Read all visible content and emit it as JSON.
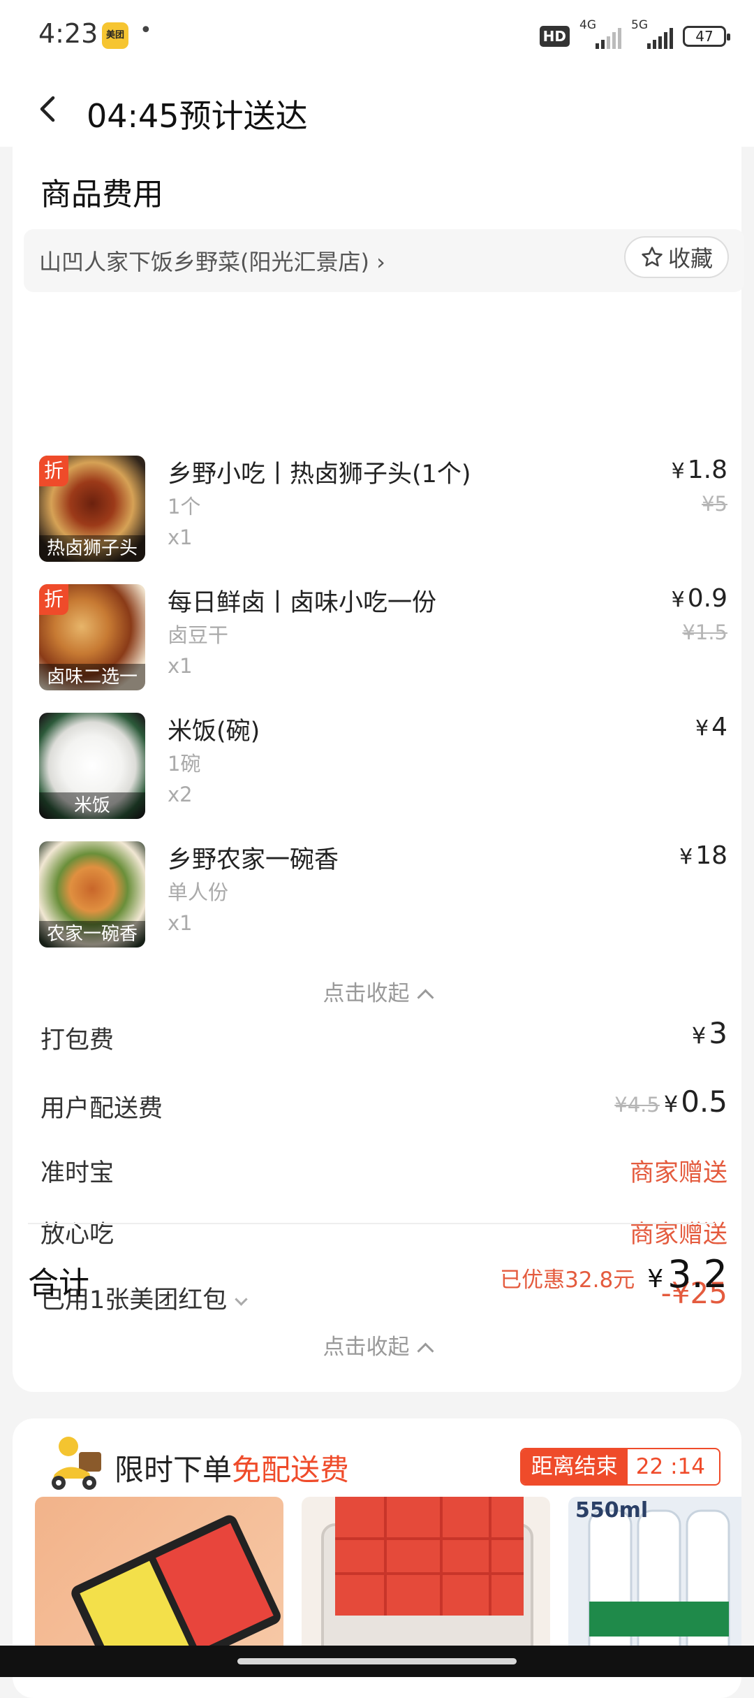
{
  "status_bar": {
    "time": "4:23",
    "app_icon_label": "美团",
    "dot": "•",
    "hd": "HD",
    "net1": "4G",
    "net2": "5G",
    "battery": "47"
  },
  "header": {
    "title": "04:45预计送达"
  },
  "goods": {
    "section_title": "商品费用",
    "shop_name": "山凹人家下饭乡野菜(阳光汇景店) ›",
    "favorite_label": "收藏",
    "items": [
      {
        "name": "乡野小吃丨热卤狮子头(1个)",
        "spec": "1个",
        "qty": "x1",
        "currency": "¥",
        "price": "1.8",
        "orig_price": "¥5",
        "tag": "折",
        "caption": "热卤狮子头"
      },
      {
        "name": "每日鲜卤丨卤味小吃一份",
        "spec": "卤豆干",
        "qty": "x1",
        "currency": "¥",
        "price": "0.9",
        "orig_price": "¥1.5",
        "tag": "折",
        "caption": "卤味二选一"
      },
      {
        "name": "米饭(碗)",
        "spec": "1碗",
        "qty": "x2",
        "currency": "¥",
        "price": "4",
        "caption": "米饭"
      },
      {
        "name": "乡野农家一碗香",
        "spec": "单人份",
        "qty": "x1",
        "currency": "¥",
        "price": "18",
        "caption": "农家一碗香"
      }
    ],
    "collapse_label": "点击收起"
  },
  "fees": {
    "packing": {
      "label": "打包费",
      "currency": "¥",
      "value": "3"
    },
    "delivery": {
      "label": "用户配送费",
      "orig": "¥4.5",
      "currency": "¥",
      "value": "0.5"
    },
    "ontime": {
      "label": "准时宝",
      "value": "商家赠送"
    },
    "safe": {
      "label": "放心吃",
      "value": "商家赠送"
    },
    "redpacket": {
      "label": "已用1张美团红包",
      "value": "-¥25"
    }
  },
  "total": {
    "label": "合计",
    "saved": "已优惠32.8元",
    "currency": "¥",
    "value": "3.2",
    "collapse_label": "点击收起"
  },
  "promo": {
    "title_part1": "限时下单",
    "title_part2": "免配送费",
    "countdown_label": "距离结束",
    "countdown_value": "22 :14",
    "bottle_text": "550ml"
  },
  "colors": {
    "accent_red": "#ef4b2a",
    "price_red": "#e45b3e"
  }
}
